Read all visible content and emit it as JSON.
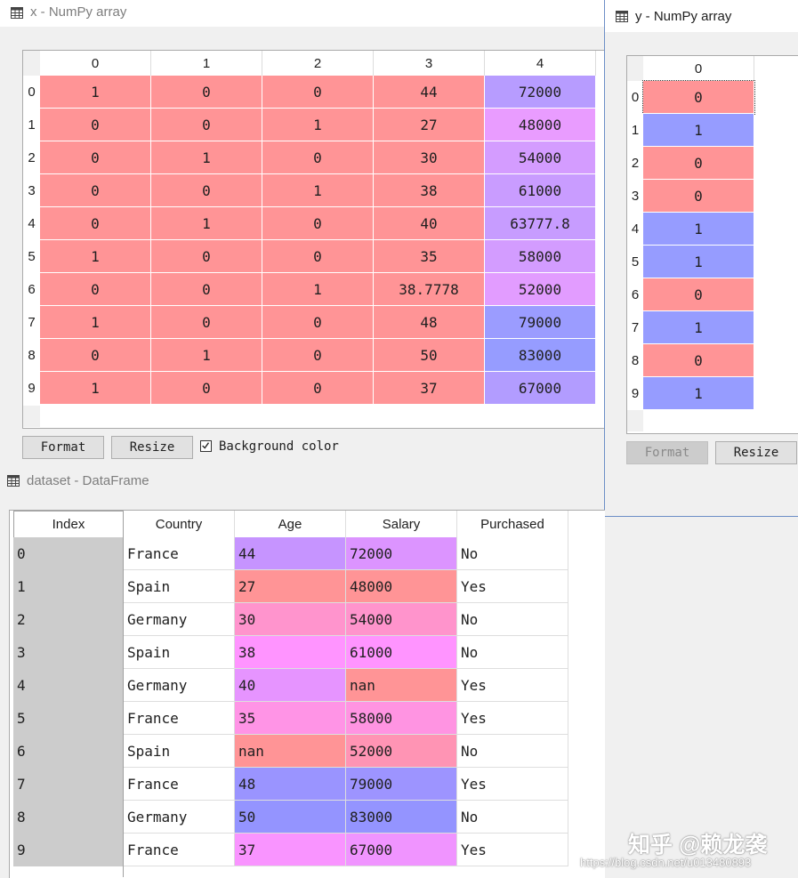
{
  "x_window": {
    "title": "x - NumPy array",
    "col_headers": [
      "0",
      "1",
      "2",
      "3",
      "4"
    ],
    "row_headers": [
      "0",
      "1",
      "2",
      "3",
      "4",
      "5",
      "6",
      "7",
      "8",
      "9"
    ],
    "rows": [
      [
        "1",
        "0",
        "0",
        "44",
        "72000"
      ],
      [
        "0",
        "0",
        "1",
        "27",
        "48000"
      ],
      [
        "0",
        "1",
        "0",
        "30",
        "54000"
      ],
      [
        "0",
        "0",
        "1",
        "38",
        "61000"
      ],
      [
        "0",
        "1",
        "0",
        "40",
        "63777.8"
      ],
      [
        "1",
        "0",
        "0",
        "35",
        "58000"
      ],
      [
        "0",
        "0",
        "1",
        "38.7778",
        "52000"
      ],
      [
        "1",
        "0",
        "0",
        "48",
        "79000"
      ],
      [
        "0",
        "1",
        "0",
        "50",
        "83000"
      ],
      [
        "1",
        "0",
        "0",
        "37",
        "67000"
      ]
    ],
    "cell_colors": [
      [
        "#ff9496",
        "#ff9496",
        "#ff9496",
        "#ff9496",
        "#b79cff"
      ],
      [
        "#ff9496",
        "#ff9496",
        "#ff9496",
        "#ff9496",
        "#e99cff"
      ],
      [
        "#ff9496",
        "#ff9496",
        "#ff9496",
        "#ff9496",
        "#d49cff"
      ],
      [
        "#ff9496",
        "#ff9496",
        "#ff9496",
        "#ff9496",
        "#c99cff"
      ],
      [
        "#ff9496",
        "#ff9496",
        "#ff9496",
        "#ff9496",
        "#c79cff"
      ],
      [
        "#ff9496",
        "#ff9496",
        "#ff9496",
        "#ff9496",
        "#d39cff"
      ],
      [
        "#ff9496",
        "#ff9496",
        "#ff9496",
        "#ff9496",
        "#e29cff"
      ],
      [
        "#ff9496",
        "#ff9496",
        "#ff9496",
        "#ff9496",
        "#9b9cff"
      ],
      [
        "#ff9496",
        "#ff9496",
        "#ff9496",
        "#ff9496",
        "#969cff"
      ],
      [
        "#ff9496",
        "#ff9496",
        "#ff9496",
        "#ff9496",
        "#b29cff"
      ]
    ],
    "format_label": "Format",
    "resize_label": "Resize",
    "bg_color_label": "Background color",
    "bg_color_checked": true
  },
  "y_window": {
    "title": "y - NumPy array",
    "col_header": "0",
    "row_headers": [
      "0",
      "1",
      "2",
      "3",
      "4",
      "5",
      "6",
      "7",
      "8",
      "9"
    ],
    "values": [
      "0",
      "1",
      "0",
      "0",
      "1",
      "1",
      "0",
      "1",
      "0",
      "1"
    ],
    "colors": {
      "0": "#ff9496",
      "1": "#969cff"
    },
    "format_label": "Format",
    "resize_label": "Resize"
  },
  "df_window": {
    "title": "dataset - DataFrame",
    "headers": [
      "Index",
      "Country",
      "Age",
      "Salary",
      "Purchased"
    ],
    "rows": [
      {
        "index": "0",
        "country": "France",
        "age": "44",
        "salary": "72000",
        "purchased": "No"
      },
      {
        "index": "1",
        "country": "Spain",
        "age": "27",
        "salary": "48000",
        "purchased": "Yes"
      },
      {
        "index": "2",
        "country": "Germany",
        "age": "30",
        "salary": "54000",
        "purchased": "No"
      },
      {
        "index": "3",
        "country": "Spain",
        "age": "38",
        "salary": "61000",
        "purchased": "No"
      },
      {
        "index": "4",
        "country": "Germany",
        "age": "40",
        "salary": "nan",
        "purchased": "Yes"
      },
      {
        "index": "5",
        "country": "France",
        "age": "35",
        "salary": "58000",
        "purchased": "Yes"
      },
      {
        "index": "6",
        "country": "Spain",
        "age": "nan",
        "salary": "52000",
        "purchased": "No"
      },
      {
        "index": "7",
        "country": "France",
        "age": "48",
        "salary": "79000",
        "purchased": "Yes"
      },
      {
        "index": "8",
        "country": "Germany",
        "age": "50",
        "salary": "83000",
        "purchased": "No"
      },
      {
        "index": "9",
        "country": "France",
        "age": "37",
        "salary": "67000",
        "purchased": "Yes"
      }
    ],
    "age_colors": [
      "#c694ff",
      "#ff9496",
      "#ff94cd",
      "#ff94ff",
      "#e694ff",
      "#ff94e6",
      "#ff9496",
      "#9a94ff",
      "#9494ff",
      "#f994ff"
    ],
    "salary_colors": [
      "#dc94ff",
      "#ff9496",
      "#ff94cc",
      "#ff94ff",
      "#ff9496",
      "#ff94e2",
      "#ff94b4",
      "#9d94ff",
      "#9494ff",
      "#f094ff"
    ]
  },
  "watermark": {
    "brand": "知乎 @赖龙袭",
    "url": "https://blog.csdn.net/u013480893"
  },
  "icons": {
    "table": "table-grid-icon",
    "check": "checkmark-icon"
  }
}
